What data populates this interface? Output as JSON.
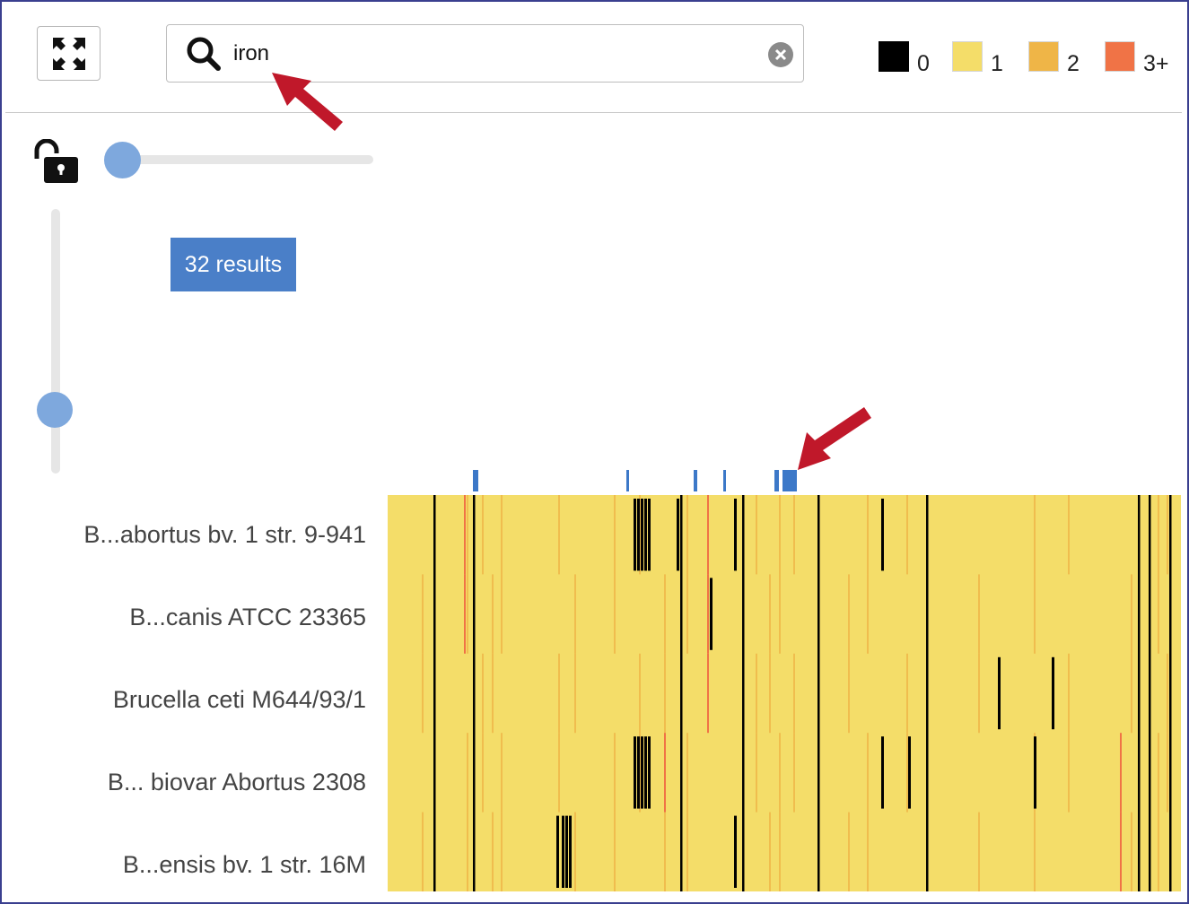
{
  "toolbar": {
    "expand_icon": "expand-fullscreen-icon",
    "search": {
      "value": "iron",
      "icon": "search-icon",
      "clear_icon": "clear-icon"
    }
  },
  "legend": [
    {
      "label": "0",
      "color": "#000000"
    },
    {
      "label": "1",
      "color": "#f4dd69"
    },
    {
      "label": "2",
      "color": "#efb547"
    },
    {
      "label": "3+",
      "color": "#f07346"
    }
  ],
  "controls": {
    "lock_icon": "unlocked-padlock-icon",
    "horizontal_slider_value": 0,
    "vertical_slider_value": 0.75,
    "results_label": "32 results"
  },
  "heatmap": {
    "rows": [
      "B...abortus bv. 1 str. 9-941",
      "B...canis ATCC 23365",
      "Brucella ceti M644/93/1",
      "B... biovar Abortus 2308",
      "B...ensis bv. 1 str. 16M"
    ],
    "search_hit_color": "#3c78c8",
    "base_color": "#f4dd69",
    "zero_color": "#000000",
    "two_color": "#efb547",
    "three_plus_color": "#f07346"
  },
  "annotations": {
    "arrow_color": "#c0182a"
  }
}
